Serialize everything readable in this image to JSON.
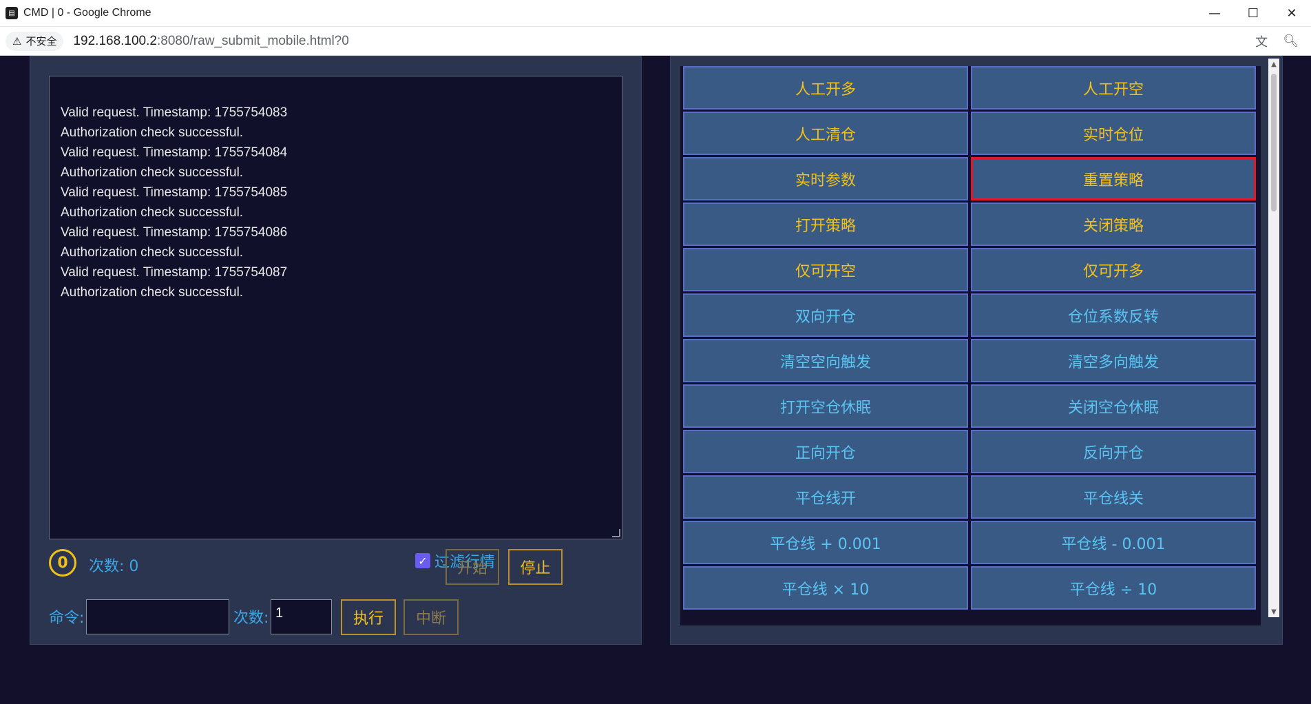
{
  "window": {
    "title": "CMD | 0 - Google Chrome",
    "minimize": "—",
    "maximize": "☐",
    "close": "✕"
  },
  "address_bar": {
    "security_label": "不安全",
    "url_host": "192.168.100.2",
    "url_path": ":8080/raw_submit_mobile.html?0"
  },
  "log": {
    "lines": [
      "Valid request. Timestamp: 1755754083",
      "Authorization check successful.",
      "Valid request. Timestamp: 1755754084",
      "Authorization check successful.",
      "Valid request. Timestamp: 1755754085",
      "Authorization check successful.",
      "Valid request. Timestamp: 1755754086",
      "Authorization check successful.",
      "Valid request. Timestamp: 1755754087",
      "Authorization check successful."
    ]
  },
  "status": {
    "counter": "0",
    "count_label": "次数:  0",
    "filter_label": "过滤行情",
    "filter_checked": true,
    "start_label": "开始",
    "stop_label": "停止"
  },
  "command": {
    "cmd_label": "命令:",
    "cmd_value": "",
    "times_label": "次数:",
    "times_value": "1",
    "execute_label": "执行",
    "interrupt_label": "中断"
  },
  "commands": [
    {
      "label": "人工开多",
      "color": "yellow"
    },
    {
      "label": "人工开空",
      "color": "yellow"
    },
    {
      "label": "人工清仓",
      "color": "yellow"
    },
    {
      "label": "实时仓位",
      "color": "yellow"
    },
    {
      "label": "实时参数",
      "color": "yellow"
    },
    {
      "label": "重置策略",
      "color": "yellow",
      "selected": true
    },
    {
      "label": "打开策略",
      "color": "yellow"
    },
    {
      "label": "关闭策略",
      "color": "yellow"
    },
    {
      "label": "仅可开空",
      "color": "yellow"
    },
    {
      "label": "仅可开多",
      "color": "yellow"
    },
    {
      "label": "双向开仓",
      "color": "blue"
    },
    {
      "label": "仓位系数反转",
      "color": "blue"
    },
    {
      "label": "清空空向触发",
      "color": "blue"
    },
    {
      "label": "清空多向触发",
      "color": "blue"
    },
    {
      "label": "打开空仓休眠",
      "color": "blue"
    },
    {
      "label": "关闭空仓休眠",
      "color": "blue"
    },
    {
      "label": "正向开仓",
      "color": "blue"
    },
    {
      "label": "反向开仓",
      "color": "blue"
    },
    {
      "label": "平仓线开",
      "color": "blue"
    },
    {
      "label": "平仓线关",
      "color": "blue"
    },
    {
      "label": "平仓线 + 0.001",
      "color": "blue"
    },
    {
      "label": "平仓线 - 0.001",
      "color": "blue"
    },
    {
      "label": "平仓线 × 10",
      "color": "blue"
    },
    {
      "label": "平仓线 ÷ 10",
      "color": "blue"
    }
  ],
  "colors": {
    "accent_yellow": "#f2c118",
    "accent_blue": "#3aa8e8",
    "button_bg": "#3a5a86",
    "selected_border": "#e01a2a"
  }
}
